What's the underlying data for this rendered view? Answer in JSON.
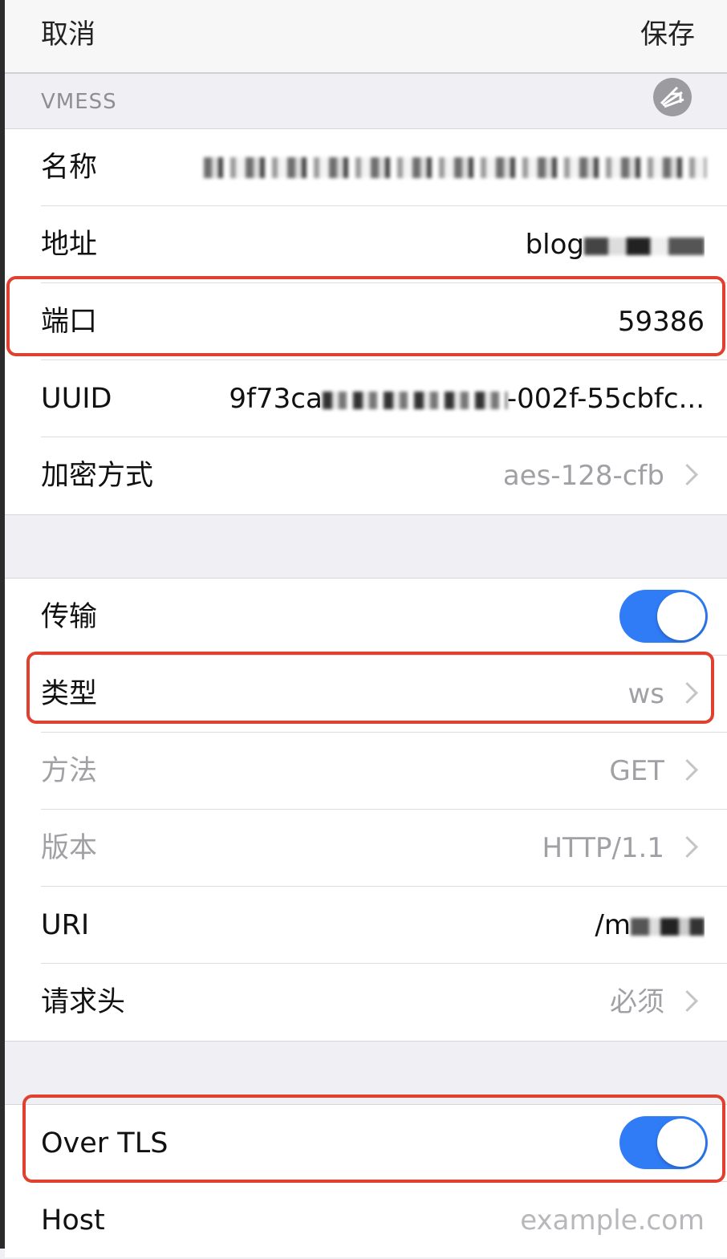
{
  "nav": {
    "cancel": "取消",
    "save": "保存"
  },
  "section": {
    "title": "VMESS",
    "share_icon": "share-icon"
  },
  "server": {
    "name_label": "名称",
    "address_label": "地址",
    "address_value": "blog",
    "port_label": "端口",
    "port_value": "59386",
    "uuid_label": "UUID",
    "uuid_prefix": "9f73ca",
    "uuid_suffix": "-002f-55cbfc...",
    "cipher_label": "加密方式",
    "cipher_value": "aes-128-cfb"
  },
  "transport": {
    "transport_label": "传输",
    "transport_enabled": true,
    "type_label": "类型",
    "type_value": "ws",
    "method_label": "方法",
    "method_value": "GET",
    "version_label": "版本",
    "version_value": "HTTP/1.1",
    "uri_label": "URI",
    "uri_value": "/m",
    "headers_label": "请求头",
    "headers_value": "必须"
  },
  "tls": {
    "over_tls_label": "Over TLS",
    "over_tls_enabled": true,
    "host_label": "Host",
    "host_placeholder": "example.com"
  },
  "colors": {
    "accent": "#2f7cf6",
    "highlight": "#e0412e"
  }
}
